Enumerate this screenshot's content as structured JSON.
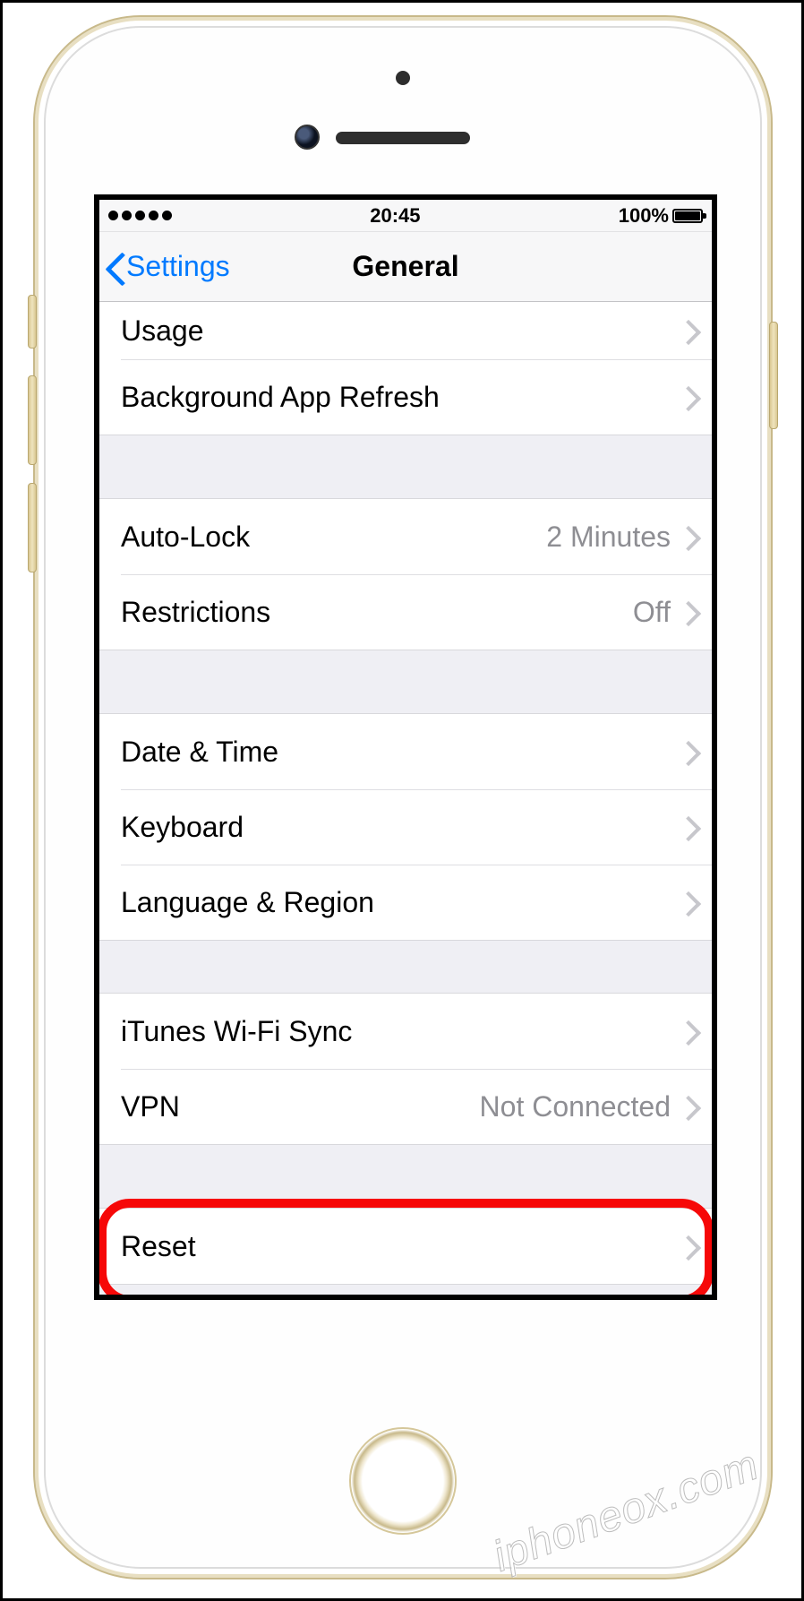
{
  "status": {
    "time": "20:45",
    "battery_text": "100%"
  },
  "nav": {
    "back_label": "Settings",
    "title": "General"
  },
  "groups": [
    {
      "id": "g1",
      "cells": [
        {
          "id": "usage",
          "label": "Usage",
          "value": ""
        },
        {
          "id": "background-app-refresh",
          "label": "Background App Refresh",
          "value": ""
        }
      ]
    },
    {
      "id": "g2",
      "cells": [
        {
          "id": "auto-lock",
          "label": "Auto-Lock",
          "value": "2 Minutes"
        },
        {
          "id": "restrictions",
          "label": "Restrictions",
          "value": "Off"
        }
      ]
    },
    {
      "id": "g3",
      "cells": [
        {
          "id": "date-time",
          "label": "Date & Time",
          "value": ""
        },
        {
          "id": "keyboard",
          "label": "Keyboard",
          "value": ""
        },
        {
          "id": "language-region",
          "label": "Language & Region",
          "value": ""
        }
      ]
    },
    {
      "id": "g4",
      "cells": [
        {
          "id": "itunes-wifi-sync",
          "label": "iTunes Wi-Fi Sync",
          "value": ""
        },
        {
          "id": "vpn",
          "label": "VPN",
          "value": "Not Connected"
        }
      ]
    },
    {
      "id": "g5",
      "cells": [
        {
          "id": "reset",
          "label": "Reset",
          "value": "",
          "highlighted": true
        }
      ]
    }
  ],
  "watermark": "iphoneox.com"
}
